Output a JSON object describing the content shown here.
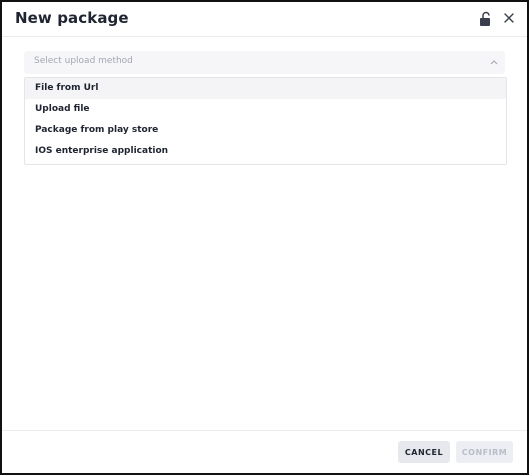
{
  "dialog": {
    "title": "New package",
    "icons": {
      "lock": "lock-open-icon",
      "close": "close-icon",
      "chevron": "chevron-up-icon"
    }
  },
  "select": {
    "placeholder": "Select upload method",
    "options": [
      {
        "label": "File from Url",
        "highlighted": true
      },
      {
        "label": "Upload file",
        "highlighted": false
      },
      {
        "label": "Package from play store",
        "highlighted": false
      },
      {
        "label": "IOS enterprise application",
        "highlighted": false
      }
    ]
  },
  "footer": {
    "cancel_label": "CANCEL",
    "confirm_label": "CONFIRM",
    "confirm_disabled": true
  }
}
